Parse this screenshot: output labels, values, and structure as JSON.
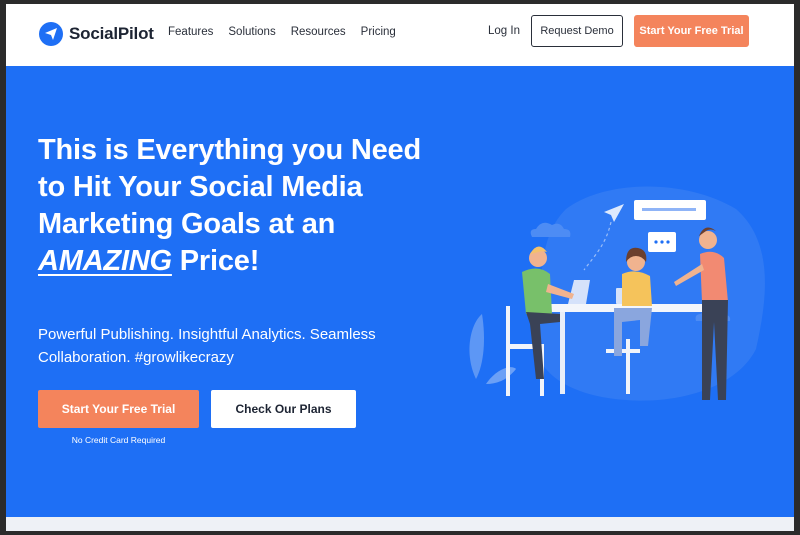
{
  "nav": {
    "logo_text": "SocialPilot",
    "links": [
      "Features",
      "Solutions",
      "Resources",
      "Pricing"
    ],
    "login": "Log In",
    "request_demo": "Request Demo",
    "free_trial": "Start Your Free Trial"
  },
  "hero": {
    "headline_line1": "This is Everything you Need",
    "headline_line2": "to Hit Your Social Media",
    "headline_line3": "Marketing Goals at an",
    "headline_emphasis": "AMAZING",
    "headline_end": " Price!",
    "subhead": "Powerful Publishing. Insightful Analytics. Seamless Collaboration. #growlikecrazy",
    "cta_primary": "Start Your Free Trial",
    "cta_secondary": "Check Our Plans",
    "cta_note": "No Credit Card Required"
  },
  "colors": {
    "brand_blue": "#1e6ff5",
    "accent_orange": "#f4845c"
  },
  "icons": {
    "logo": "paper-plane-icon"
  }
}
